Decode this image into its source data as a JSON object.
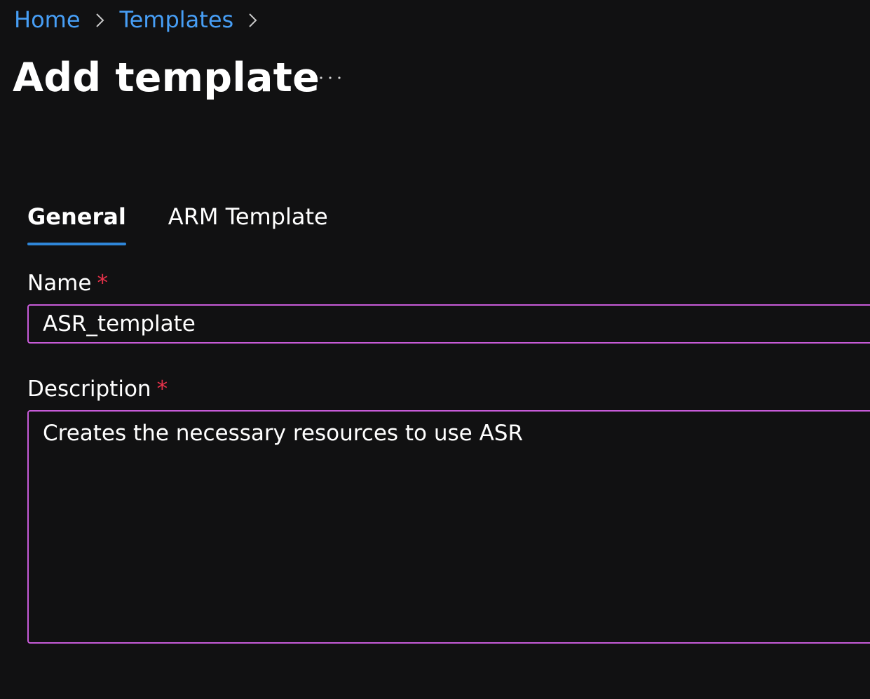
{
  "breadcrumb": {
    "items": [
      {
        "label": "Home"
      },
      {
        "label": "Templates"
      }
    ]
  },
  "header": {
    "title": "Add template",
    "more_icon": "ellipsis-icon"
  },
  "tabs": [
    {
      "label": "General",
      "active": true
    },
    {
      "label": "ARM Template",
      "active": false
    }
  ],
  "form": {
    "name": {
      "label": "Name",
      "required_marker": "*",
      "value": "ASR_template"
    },
    "description": {
      "label": "Description",
      "required_marker": "*",
      "value": "Creates the necessary resources to use ASR"
    }
  },
  "colors": {
    "background": "#111112",
    "link": "#479ef5",
    "tab_indicator": "#2f86d9",
    "required": "#e9324b",
    "input_border_focus": "#c75bd8"
  }
}
